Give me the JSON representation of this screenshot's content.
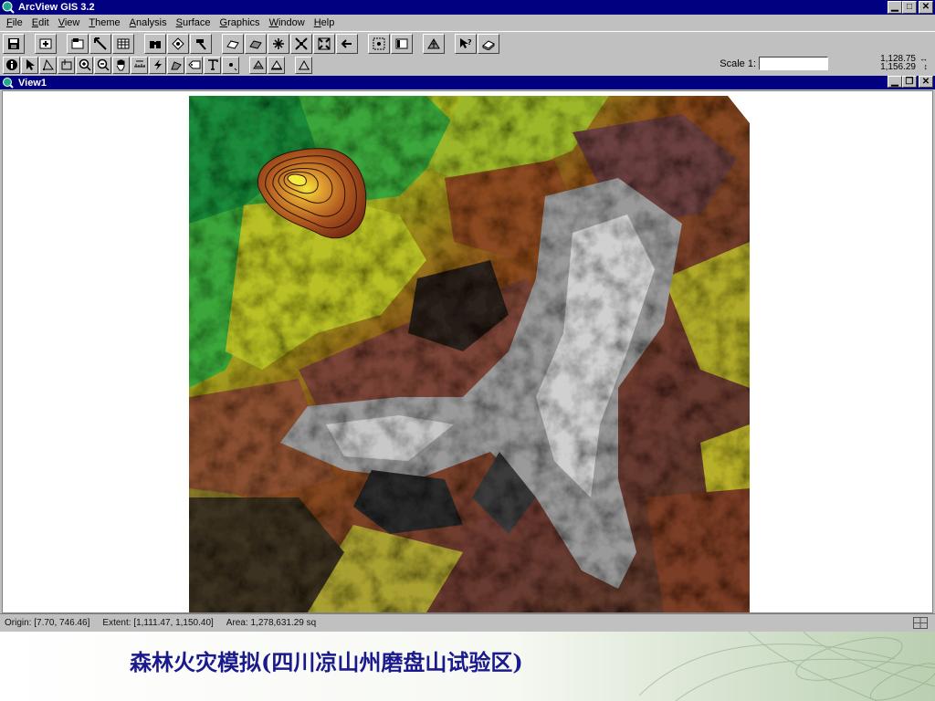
{
  "window": {
    "title": "ArcView GIS 3.2"
  },
  "menu": [
    "File",
    "Edit",
    "View",
    "Theme",
    "Analysis",
    "Surface",
    "Graphics",
    "Window",
    "Help"
  ],
  "menu_underline": [
    "F",
    "E",
    "V",
    "T",
    "A",
    "S",
    "G",
    "W",
    "H"
  ],
  "scale": {
    "label": "Scale 1:",
    "value": ""
  },
  "coords": {
    "x": "1,128.75",
    "y": "1,156.29"
  },
  "view": {
    "title": "View1"
  },
  "status": {
    "origin": "Origin: [7.70, 746.46]",
    "extent": "Extent: [1,111.47, 1,150.40]",
    "area": "Area: 1,278,631.29 sq"
  },
  "caption": "森林火灾模拟(四川凉山州磨盘山试验区)",
  "colors": {
    "title_bar": "#000080",
    "caption_text": "#1a1a8c",
    "face": "#c0c0c0"
  }
}
